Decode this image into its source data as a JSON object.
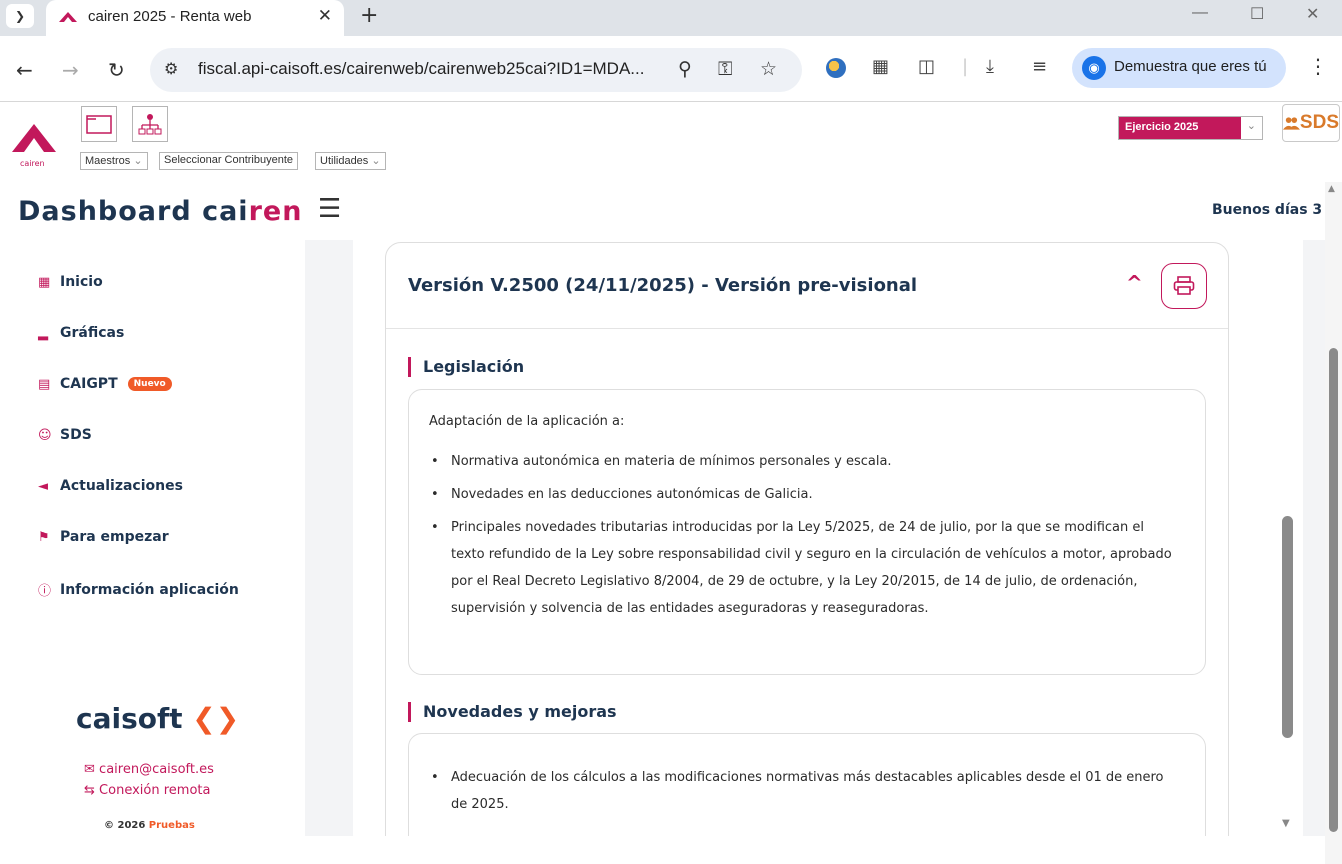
{
  "browser": {
    "tab_title": "cairen 2025 - Renta web",
    "url": "fiscal.api-caisoft.es/cairenweb/cairenweb25cai?ID1=MDA...",
    "profile_label": "Demuestra que eres tú"
  },
  "app_bar": {
    "brand_caption": "cairen",
    "menus": [
      "Maestros",
      "Seleccionar Contribuyente",
      "Utilidades"
    ],
    "ejercicio": "Ejercicio 2025",
    "sds_label": "SDS"
  },
  "header": {
    "title_main": "Dashboard ",
    "title_cai": "cai",
    "title_ren": "ren",
    "greeting": "Buenos días 3"
  },
  "sidebar": {
    "items": [
      {
        "label": "Inicio",
        "icon": "grid-icon"
      },
      {
        "label": "Gráficas",
        "icon": "bar-chart-icon"
      },
      {
        "label": "CAIGPT",
        "icon": "chat-icon",
        "badge": "Nuevo"
      },
      {
        "label": "SDS",
        "icon": "user-icon"
      },
      {
        "label": "Actualizaciones",
        "icon": "megaphone-icon"
      },
      {
        "label": "Para empezar",
        "icon": "flag-icon"
      },
      {
        "label": "Información aplicación",
        "icon": "info-icon"
      }
    ],
    "logo_text": "caisoft",
    "email": "cairen@caisoft.es",
    "remote": "Conexión remota",
    "copyright_prefix": "© 2026 ",
    "copyright_name": "Pruebas"
  },
  "main": {
    "version_title": "Versión V.2500 (24/11/2025) - Versión pre-visional",
    "sections": [
      {
        "title": "Legislación",
        "intro": "Adaptación de la aplicación a:",
        "bullets": [
          "Normativa autonómica en materia de mínimos personales y escala.",
          "Novedades en las deducciones autonómicas de Galicia.",
          "Principales novedades tributarias introducidas por la Ley 5/2025, de 24 de julio, por la que se modifican el texto refundido de la Ley sobre responsabilidad civil y seguro en la circulación de vehículos a motor, aprobado por el Real Decreto Legislativo 8/2004, de 29 de octubre, y la Ley 20/2015, de 14 de julio, de ordenación, supervisión y solvencia de las entidades aseguradoras y reaseguradoras."
        ]
      },
      {
        "title": "Novedades y mejoras",
        "bullets": [
          "Adecuación de los cálculos a las modificaciones normativas más destacables aplicables desde el 01 de enero de 2025."
        ]
      }
    ]
  },
  "colors": {
    "accent": "#c2185b",
    "navy": "#1e3550",
    "orange": "#f05a28"
  }
}
